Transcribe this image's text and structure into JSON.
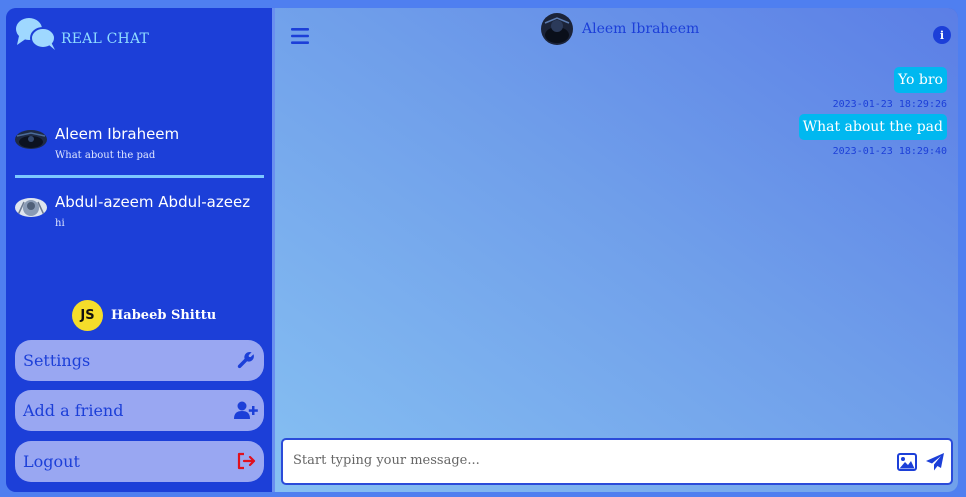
{
  "sidebar": {
    "logo_text": "REAL CHAT",
    "chats": [
      {
        "name": "Aleem Ibraheem",
        "last_message": "What about the pad",
        "active": true
      },
      {
        "name": "Abdul-azeem Abdul-azeez",
        "last_message": "hi",
        "active": false
      }
    ],
    "user": {
      "badge": "JS",
      "name": "Habeeb Shittu"
    },
    "menu": {
      "settings_label": "Settings",
      "add_friend_label": "Add a friend",
      "logout_label": "Logout"
    }
  },
  "header": {
    "contact_name": "Aleem Ibraheem",
    "info_glyph": "i"
  },
  "messages": [
    {
      "text": "Yo bro",
      "time": "2023-01-23 18:29:26"
    },
    {
      "text": "What about the pad",
      "time": "2023-01-23 18:29:40"
    }
  ],
  "composer": {
    "placeholder": "Start typing your message..."
  },
  "colors": {
    "sidebar": "#1c3fd8",
    "accent": "#00b8f0",
    "menu_button": "#99a7f2",
    "logout_icon": "#e0101e"
  },
  "icons": [
    "chat-bubbles-icon",
    "hamburger-icon",
    "info-icon",
    "wrench-icon",
    "add-user-icon",
    "logout-icon",
    "image-icon",
    "send-icon"
  ]
}
